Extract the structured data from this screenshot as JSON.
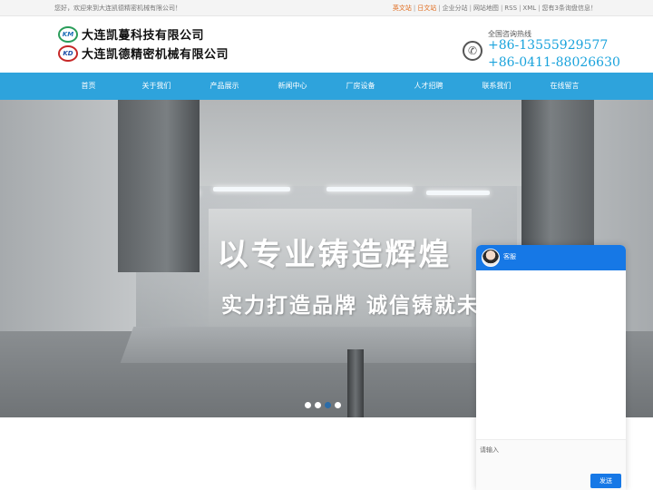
{
  "topbar": {
    "welcome": "您好，欢迎来到大连凯德精密机械有限公司！",
    "links": [
      {
        "label": "英文站",
        "lang": true
      },
      {
        "label": "日文站",
        "lang": true
      },
      {
        "label": "企业分站",
        "lang": false
      },
      {
        "label": "网站地图",
        "lang": false
      },
      {
        "label": "RSS",
        "lang": false
      },
      {
        "label": "XML",
        "lang": false
      },
      {
        "label": "您有3条询盘信息！",
        "lang": false
      }
    ]
  },
  "header": {
    "logo1": {
      "badge": "KM",
      "name": "大连凯蔓科技有限公司"
    },
    "logo2": {
      "badge": "KD",
      "name": "大连凯德精密机械有限公司"
    },
    "hotline_label": "全国咨询热线",
    "phone1": "+86-13555929577",
    "phone2": "+86-0411-88026630",
    "phone_icon": "phone-icon"
  },
  "nav": {
    "items": [
      "首页",
      "关于我们",
      "产品展示",
      "新闻中心",
      "厂房设备",
      "人才招聘",
      "联系我们",
      "在线留言"
    ]
  },
  "banner": {
    "headline1": "以专业铸造辉煌",
    "headline2": "实力打造品牌 诚信铸就未来",
    "slide_count": 4,
    "active_slide": 3
  },
  "chat": {
    "title": "客服",
    "input_placeholder": "请输入",
    "send_label": "发送",
    "accent": "#1678e6"
  },
  "colors": {
    "nav_bg": "#2ea3dc",
    "phone_text": "#1aa3dc",
    "lang_link": "#e06a1b"
  }
}
